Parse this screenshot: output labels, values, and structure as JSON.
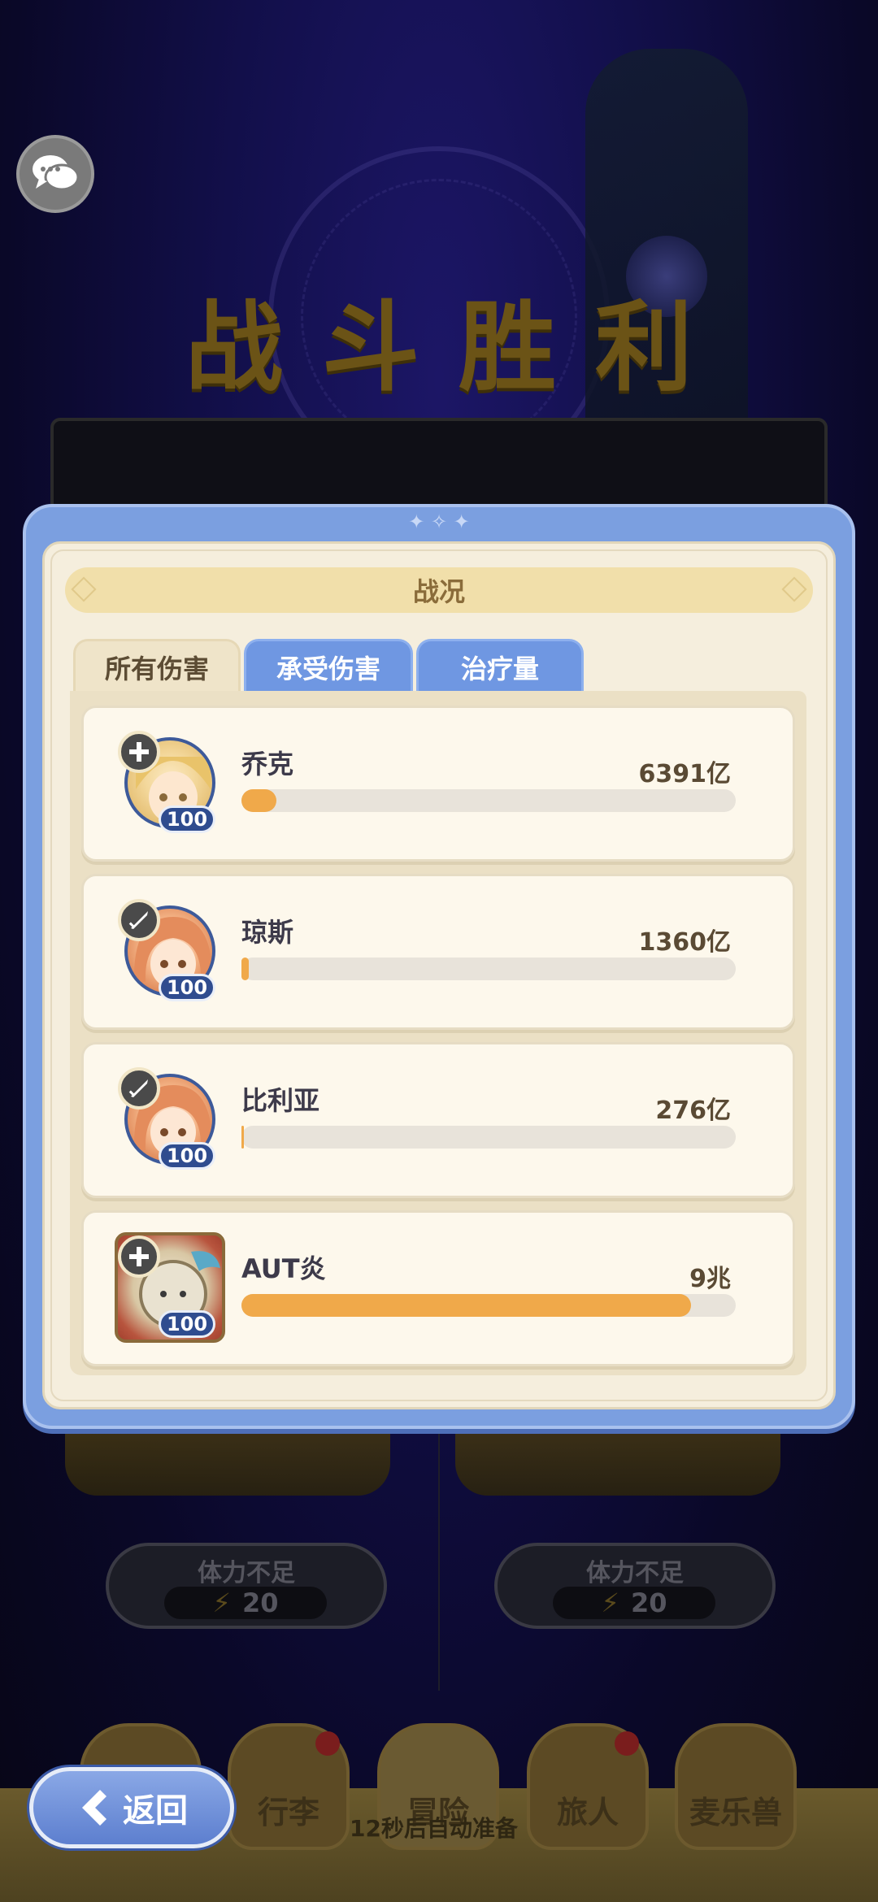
{
  "background": {
    "title": "战斗胜利",
    "stamina_cards": [
      {
        "label": "体力不足",
        "cost": "20"
      },
      {
        "label": "体力不足",
        "cost": "20"
      }
    ],
    "countdown": "12秒后自动准备"
  },
  "nav": {
    "back_label": "返回",
    "items": [
      {
        "label": "行李",
        "badge": true
      },
      {
        "label": "冒险",
        "badge": false
      },
      {
        "label": "旅人",
        "badge": true
      },
      {
        "label": "麦乐兽",
        "badge": false
      }
    ]
  },
  "modal": {
    "header": "战况",
    "tabs": [
      {
        "label": "所有伤害",
        "active": true
      },
      {
        "label": "承受伤害",
        "active": false
      },
      {
        "label": "治疗量",
        "active": false
      }
    ],
    "rows": [
      {
        "name": "乔克",
        "value": "6391亿",
        "level": "100",
        "fill": 0.07,
        "class_icon": "shield-icon"
      },
      {
        "name": "琼斯",
        "value": "1360亿",
        "level": "100",
        "fill": 0.015,
        "class_icon": "sword-icon"
      },
      {
        "name": "比利亚",
        "value": "276亿",
        "level": "100",
        "fill": 0.005,
        "class_icon": "sword-icon"
      },
      {
        "name": "AUT炎",
        "value": "9兆",
        "level": "100",
        "fill": 0.91,
        "class_icon": "shield-icon"
      }
    ]
  },
  "colors": {
    "accent_blue": "#7b9fe0",
    "bar_orange": "#f0a94a",
    "panel_cream": "#f5eedd"
  }
}
